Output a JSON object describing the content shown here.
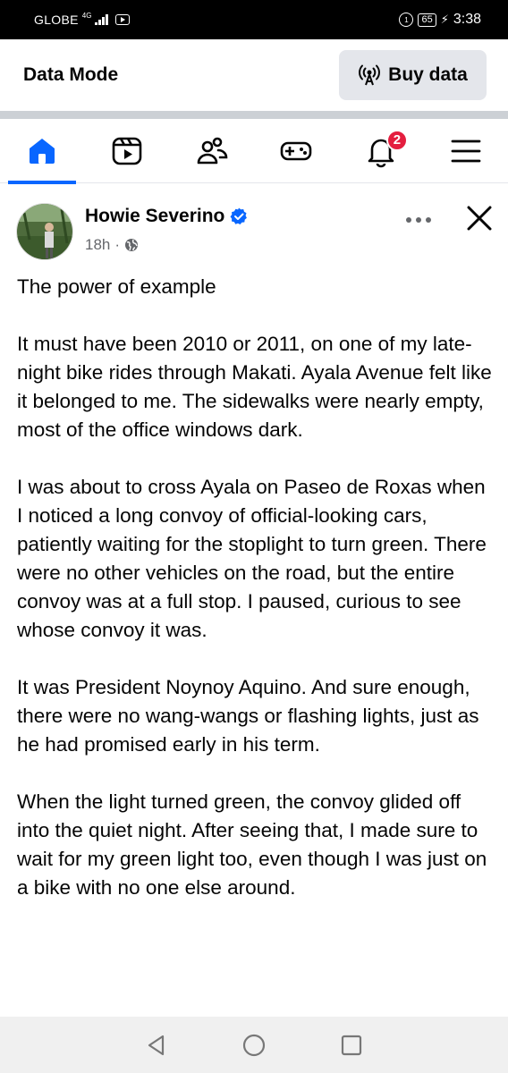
{
  "status_bar": {
    "carrier": "GLOBE",
    "network": "4G",
    "battery": "65",
    "time": "3:38"
  },
  "data_mode": {
    "title": "Data Mode",
    "buy_label": "Buy data",
    "buy_icon": "broadcast-icon"
  },
  "nav": {
    "items": [
      {
        "name": "home",
        "icon": "home-icon",
        "active": true
      },
      {
        "name": "video",
        "icon": "video-icon",
        "active": false
      },
      {
        "name": "friends",
        "icon": "friends-icon",
        "active": false
      },
      {
        "name": "gaming",
        "icon": "gamepad-icon",
        "active": false
      },
      {
        "name": "notifications",
        "icon": "bell-icon",
        "active": false,
        "badge": "2"
      },
      {
        "name": "menu",
        "icon": "hamburger-icon",
        "active": false
      }
    ]
  },
  "post": {
    "author": "Howie Severino",
    "time": "18h",
    "separator": "·",
    "paragraphs": [
      "The power of example",
      "It must have been 2010 or 2011, on one of my late-night bike rides through Makati. Ayala Avenue felt like it belonged to me. The sidewalks were nearly empty, most of the office windows dark.",
      "I was about to cross Ayala on Paseo de Roxas when I noticed a long convoy of official-looking cars, patiently waiting for the stoplight to turn green. There were no other vehicles on the road, but the entire convoy was at a full stop. I paused, curious to see whose convoy it was.",
      "It was President Noynoy Aquino. And sure enough, there were no wang-wangs or flashing lights, just as he had promised early in his term.",
      "When the light turned green, the convoy glided off into the quiet night. After seeing that, I made sure to wait for my green light too, even though I was just on a bike with no one else around."
    ]
  },
  "colors": {
    "accent": "#0866ff",
    "badge": "#e41e3f",
    "muted": "#65676b",
    "button_bg": "#e4e6eb"
  }
}
